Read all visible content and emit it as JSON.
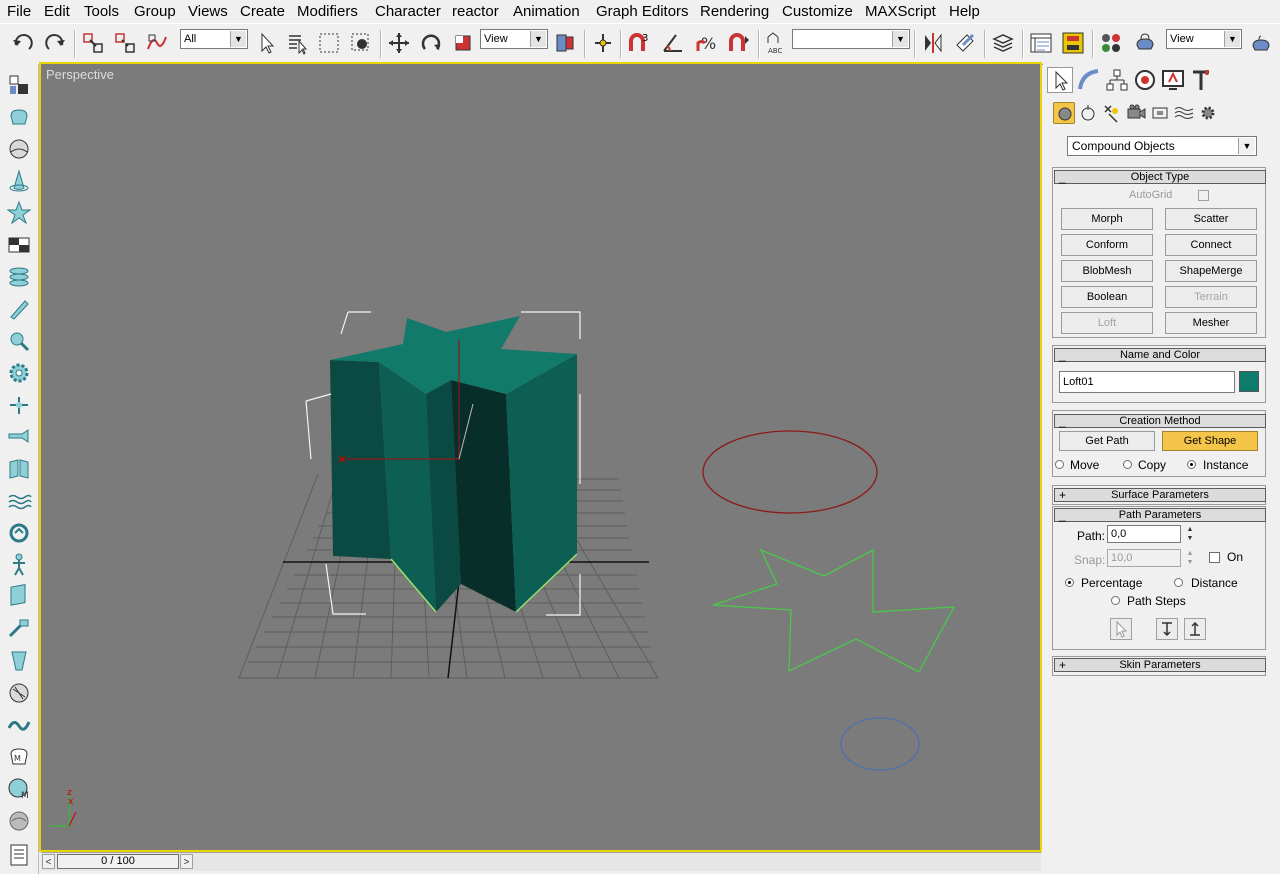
{
  "menu": [
    "File",
    "Edit",
    "Tools",
    "Group",
    "Views",
    "Create",
    "Modifiers",
    "Character",
    "reactor",
    "Animation",
    "Graph Editors",
    "Rendering",
    "Customize",
    "MAXScript",
    "Help"
  ],
  "toolbar": {
    "selection_filter": "All",
    "ref_coord": "View",
    "named_selection": "",
    "render_view": "View",
    "snap_angle_label": "3"
  },
  "viewport": {
    "label": "Perspective",
    "axis_x": "x",
    "axis_z": "z"
  },
  "timeline": {
    "frame": "0 / 100",
    "prev": "<",
    "next": ">"
  },
  "command_panel": {
    "category": "Compound Objects",
    "object_type": {
      "title": "Object Type",
      "autogrid": "AutoGrid",
      "buttons": [
        {
          "label": "Morph",
          "state": "normal"
        },
        {
          "label": "Scatter",
          "state": "normal"
        },
        {
          "label": "Conform",
          "state": "normal"
        },
        {
          "label": "Connect",
          "state": "normal"
        },
        {
          "label": "BlobMesh",
          "state": "normal"
        },
        {
          "label": "ShapeMerge",
          "state": "normal"
        },
        {
          "label": "Boolean",
          "state": "normal"
        },
        {
          "label": "Terrain",
          "state": "disabled"
        },
        {
          "label": "Loft",
          "state": "disabled"
        },
        {
          "label": "Mesher",
          "state": "normal"
        }
      ]
    },
    "name_color": {
      "title": "Name and Color",
      "name": "Loft01",
      "color": "#0e7c6c"
    },
    "creation_method": {
      "title": "Creation Method",
      "get_path": "Get Path",
      "get_shape": "Get Shape",
      "move": "Move",
      "copy": "Copy",
      "instance": "Instance"
    },
    "surface_parameters": {
      "title": "Surface Parameters"
    },
    "path_parameters": {
      "title": "Path Parameters",
      "path_label": "Path:",
      "path_value": "0,0",
      "snap_label": "Snap:",
      "snap_value": "10,0",
      "on": "On",
      "percentage": "Percentage",
      "distance": "Distance",
      "path_steps": "Path Steps"
    },
    "skin_parameters": {
      "title": "Skin Parameters"
    },
    "collapse_minus": "_",
    "expand_plus": "+"
  },
  "colors": {
    "viewport_bg": "#7b7b7b",
    "active_border": "#e8d400",
    "loft_teal": "#0e5f53",
    "circle_path": "#8b1a1a",
    "star_shape": "#4ac84a",
    "small_circle": "#4a6fb0",
    "active_button": "#f5c54a"
  }
}
